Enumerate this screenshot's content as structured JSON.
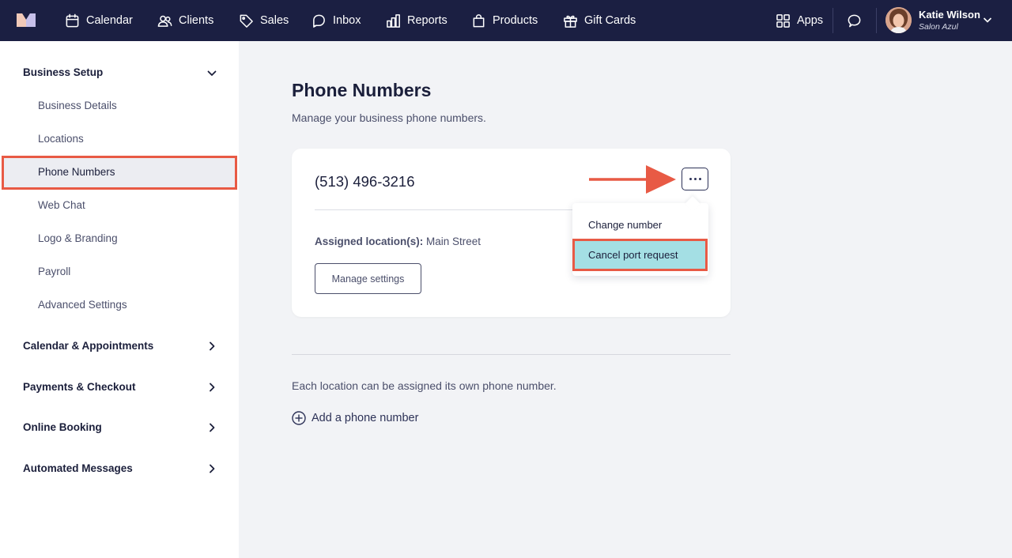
{
  "nav": {
    "items": [
      {
        "label": "Calendar",
        "icon": "calendar-icon"
      },
      {
        "label": "Clients",
        "icon": "clients-icon"
      },
      {
        "label": "Sales",
        "icon": "tag-icon"
      },
      {
        "label": "Inbox",
        "icon": "inbox-icon"
      },
      {
        "label": "Reports",
        "icon": "bar-chart-icon"
      },
      {
        "label": "Products",
        "icon": "shopping-bag-icon"
      },
      {
        "label": "Gift Cards",
        "icon": "gift-icon"
      }
    ],
    "apps_label": "Apps",
    "user_name": "Katie Wilson",
    "user_business": "Salon Azul"
  },
  "sidebar": {
    "sections": [
      {
        "label": "Business Setup",
        "expanded": true
      },
      {
        "label": "Calendar & Appointments",
        "expanded": false
      },
      {
        "label": "Payments & Checkout",
        "expanded": false
      },
      {
        "label": "Online Booking",
        "expanded": false
      },
      {
        "label": "Automated Messages",
        "expanded": false
      }
    ],
    "items": [
      {
        "label": "Business Details"
      },
      {
        "label": "Locations"
      },
      {
        "label": "Phone Numbers",
        "active": true
      },
      {
        "label": "Web Chat"
      },
      {
        "label": "Logo & Branding"
      },
      {
        "label": "Payroll"
      },
      {
        "label": "Advanced Settings"
      }
    ]
  },
  "main": {
    "title": "Phone Numbers",
    "subtitle": "Manage your business phone numbers.",
    "card": {
      "phone": "(513) 496-3216",
      "assigned_label": "Assigned location(s):",
      "assigned_value": "Main Street",
      "manage_button": "Manage settings"
    },
    "menu": {
      "items": [
        "Change number",
        "Cancel port request"
      ]
    },
    "info_text": "Each location can be assigned its own phone number.",
    "add_link": "Add a phone number"
  },
  "colors": {
    "nav_bg": "#1b1f42",
    "highlight_border": "#e85a45",
    "menu_highlight": "#a4dfe4"
  }
}
